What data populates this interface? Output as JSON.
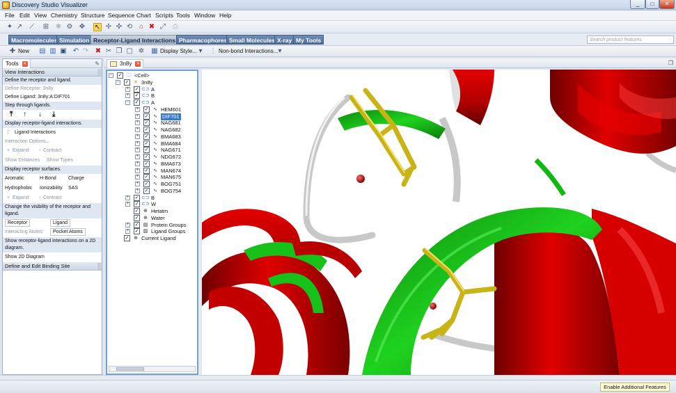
{
  "window": {
    "title": "Discovery Studio Visualizer"
  },
  "menu": [
    "File",
    "Edit",
    "View",
    "Chemistry",
    "Structure",
    "Sequence",
    "Chart",
    "Scripts",
    "Tools",
    "Window",
    "Help"
  ],
  "perspectives": [
    "Macromolecules",
    "Simulation",
    "Receptor-Ligand Interactions",
    "Pharmacophores",
    "Small Molecules",
    "X-ray",
    "My Tools"
  ],
  "active_perspective": "Receptor-Ligand Interactions",
  "search": {
    "placeholder": "Search product features"
  },
  "toolbar2": {
    "new_label": "New",
    "display_style": "Display Style...",
    "nonbond": "Non-bond Interactions..."
  },
  "tools": {
    "tab_label": "Tools",
    "view_interactions": "View Interactions",
    "define_receptor_and_ligand": "Define the receptor and ligand.",
    "define_receptor": "Define Receptor: 3n8y",
    "define_ligand": "Define Ligand: 3n8y:A:DIF701",
    "step_through": "Step through ligands.",
    "display_interactions": "Display receptor-ligand interactions.",
    "ligand_interactions": "Ligand Interactions",
    "interaction_options": "Interaction Options...",
    "expand1": "Expand",
    "contract1": "Contract",
    "show_distances": "Show Distances",
    "show_types": "Show Types",
    "display_surfaces": "Display receptor surfaces.",
    "aromatic": "Aromatic",
    "hbond": "H-Bond",
    "charge": "Charge",
    "hydrophobic": "Hydrophobic",
    "ionizability": "Ionizability",
    "sas": "SAS",
    "expand2": "Expand",
    "contract2": "Contract",
    "change_visibility": "Change the visibility of the receptor and ligand.",
    "receptor_tab": "Receptor",
    "ligand_tab": "Ligand",
    "interacting_atoms": "Interacting Atoms",
    "pocket_atoms": "Pocket Atoms",
    "show_2d_desc": "Show receptor-ligand interactions on a 2D diagram.",
    "show_2d": "Show 2D Diagram",
    "define_site": "Define and Edit Binding Site"
  },
  "document": {
    "tab_label": "3n8y"
  },
  "tree": {
    "cell": "<Cell>",
    "molecule": "3n8y",
    "chain_a": "A",
    "chain_b": "B",
    "chain_a_het": "A",
    "hets": [
      "HEM601",
      "DIF701",
      "NAG681",
      "NAG682",
      "BMA683",
      "BMA684",
      "NAG671",
      "NDG672",
      "BMA673",
      "MAN674",
      "MAN675",
      "BOG751",
      "BOG754"
    ],
    "selected_het": "DIF701",
    "chain_b2": "B",
    "chain_w": "W",
    "hetatm": "Hetatm",
    "water": "Water",
    "protein_groups": "Protein Groups",
    "ligand_groups": "Ligand Groups",
    "current_ligand": "Current Ligand"
  },
  "status": {
    "enable_features": "Enable Additional Features"
  },
  "colors": {
    "helix": "#d40000",
    "strand": "#18c118",
    "coil": "#c9c9c9",
    "ligand": "#c9b417",
    "water": "#a30b0b"
  }
}
